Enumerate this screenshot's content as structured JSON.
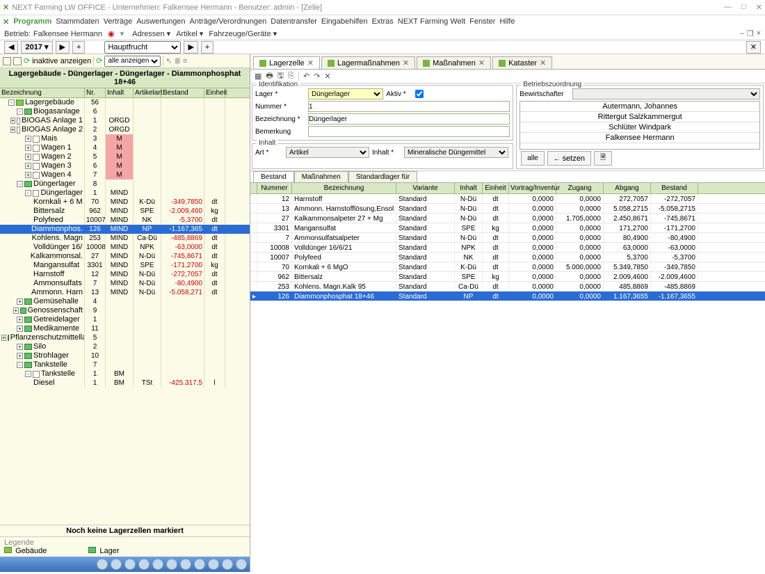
{
  "window": {
    "title": "NEXT Farming LW OFFICE - Unternehmen: Falkensee Hermann - Benutzer: admin - [Zelle]"
  },
  "menu": [
    "Programm",
    "Stammdaten",
    "Verträge",
    "Auswertungen",
    "Anträge/Verordnungen",
    "Datentransfer",
    "Eingabehilfen",
    "Extras",
    "NEXT Farming Welt",
    "Fenster",
    "Hilfe"
  ],
  "toolbar1": {
    "betrieb_label": "Betrieb:",
    "betrieb": "Falkensee Hermann",
    "items": [
      "Adressen",
      "Artikel",
      "Fahrzeuge/Geräte"
    ]
  },
  "yearbar": {
    "year": "2017 ▾",
    "crop": "Hauptfrucht"
  },
  "left": {
    "filter1": "inaktive anzeigen",
    "filter2": "alle anzeigen",
    "breadcrumb": "Lagergebäude - Düngerlager - Düngerlager - Diammonphosphat 18+46",
    "cols": [
      "Bezeichnung",
      "Nr.",
      "Inhalt",
      "Artikelart",
      "Bestand",
      "Einheit"
    ],
    "rows": [
      {
        "d": 0,
        "e": "-",
        "i": "bld",
        "bez": "Lagergebäude",
        "nr": "56"
      },
      {
        "d": 1,
        "e": "-",
        "i": "lag",
        "bez": "Biogasanlage",
        "nr": "6"
      },
      {
        "d": 2,
        "e": "+",
        "i": "chk",
        "bez": "BIOGAS Anlage 1",
        "nr": "1",
        "inh": "ORGD"
      },
      {
        "d": 2,
        "e": "+",
        "i": "chk",
        "bez": "BIOGAS Anlage 2",
        "nr": "2",
        "inh": "ORGD"
      },
      {
        "d": 2,
        "e": "+",
        "i": "chk",
        "bez": "Mais",
        "nr": "3",
        "inh": "M",
        "pink": true
      },
      {
        "d": 2,
        "e": "+",
        "i": "chk",
        "bez": "Wagen 1",
        "nr": "4",
        "inh": "M",
        "pink": true
      },
      {
        "d": 2,
        "e": "+",
        "i": "chk",
        "bez": "Wagen 2",
        "nr": "5",
        "inh": "M",
        "pink": true
      },
      {
        "d": 2,
        "e": "+",
        "i": "chk",
        "bez": "Wagen 3",
        "nr": "6",
        "inh": "M",
        "pink": true
      },
      {
        "d": 2,
        "e": "+",
        "i": "chk",
        "bez": "Wagen 4",
        "nr": "7",
        "inh": "M",
        "pink": true
      },
      {
        "d": 1,
        "e": "-",
        "i": "lag",
        "bez": "Düngerlager",
        "nr": "8"
      },
      {
        "d": 2,
        "e": "-",
        "i": "chk",
        "bez": "Düngerlager",
        "nr": "1",
        "inh": "MIND"
      },
      {
        "d": 3,
        "bez": "Kornkali + 6 M",
        "nr": "70",
        "inh": "MIND",
        "art": "K-Dü",
        "bes": "-349,7850",
        "ein": "dt",
        "neg": true
      },
      {
        "d": 3,
        "bez": "Bittersalz",
        "nr": "962",
        "inh": "MIND",
        "art": "SPE",
        "bes": "-2.009,460",
        "ein": "kg",
        "neg": true
      },
      {
        "d": 3,
        "bez": "Polyfeed",
        "nr": "10007",
        "inh": "MIND",
        "art": "NK",
        "bes": "-5,3700",
        "ein": "dt",
        "neg": true
      },
      {
        "d": 3,
        "bez": "Diammonphos.",
        "nr": "126",
        "inh": "MIND",
        "art": "NP",
        "bes": "-1.167,365",
        "ein": "dt",
        "neg": true,
        "sel": true
      },
      {
        "d": 3,
        "bez": "Kohlens. Magn",
        "nr": "253",
        "inh": "MIND",
        "art": "Ca-Dü",
        "bes": "-485,8869",
        "ein": "dt",
        "neg": true
      },
      {
        "d": 3,
        "bez": "Volldünger 16/",
        "nr": "10008",
        "inh": "MIND",
        "art": "NPK",
        "bes": "-63,0000",
        "ein": "dt",
        "neg": true
      },
      {
        "d": 3,
        "bez": "Kalkammonsal.",
        "nr": "27",
        "inh": "MIND",
        "art": "N-Dü",
        "bes": "-745,8671",
        "ein": "dt",
        "neg": true
      },
      {
        "d": 3,
        "bez": "Mangansulfat",
        "nr": "3301",
        "inh": "MIND",
        "art": "SPE",
        "bes": "-171,2700",
        "ein": "kg",
        "neg": true
      },
      {
        "d": 3,
        "bez": "Harnstoff",
        "nr": "12",
        "inh": "MIND",
        "art": "N-Dü",
        "bes": "-272,7057",
        "ein": "dt",
        "neg": true
      },
      {
        "d": 3,
        "bez": "Ammonsulfats",
        "nr": "7",
        "inh": "MIND",
        "art": "N-Dü",
        "bes": "-80,4900",
        "ein": "dt",
        "neg": true
      },
      {
        "d": 3,
        "bez": "Ammonn. Harn",
        "nr": "13",
        "inh": "MIND",
        "art": "N-Dü",
        "bes": "-5.058,271",
        "ein": "dt",
        "neg": true
      },
      {
        "d": 1,
        "e": "+",
        "i": "lag",
        "bez": "Gemüsehalle",
        "nr": "4"
      },
      {
        "d": 1,
        "e": "+",
        "i": "lag",
        "bez": "Genossenschaft",
        "nr": "9"
      },
      {
        "d": 1,
        "e": "+",
        "i": "lag",
        "bez": "Getreidelager",
        "nr": "1"
      },
      {
        "d": 1,
        "e": "+",
        "i": "lag",
        "bez": "Medikamente",
        "nr": "11"
      },
      {
        "d": 1,
        "e": "+",
        "i": "lag",
        "bez": "Pflanzenschutzmittella",
        "nr": "5"
      },
      {
        "d": 1,
        "e": "+",
        "i": "lag",
        "bez": "Silo",
        "nr": "2"
      },
      {
        "d": 1,
        "e": "+",
        "i": "lag",
        "bez": "Strohlager",
        "nr": "10"
      },
      {
        "d": 1,
        "e": "-",
        "i": "lag",
        "bez": "Tankstelle",
        "nr": "7"
      },
      {
        "d": 2,
        "e": "-",
        "i": "chk",
        "bez": "Tankstelle",
        "nr": "1",
        "inh": "BM"
      },
      {
        "d": 3,
        "bez": "Diesel",
        "nr": "1",
        "inh": "BM",
        "art": "TSt",
        "bes": "-425.317,5",
        "ein": "l",
        "neg": true
      }
    ],
    "status": "Noch keine Lagerzellen markiert",
    "legend_title": "Legende",
    "legend1": "Gebäude",
    "legend2": "Lager"
  },
  "right": {
    "tabs": [
      {
        "label": "Lagerzelle",
        "active": true
      },
      {
        "label": "Lagermaßnahmen"
      },
      {
        "label": "Maßnahmen"
      },
      {
        "label": "Kataster"
      }
    ],
    "ident": {
      "title": "Identifikation",
      "lager_label": "Lager",
      "lager": "Düngerlager",
      "aktiv_label": "Aktiv",
      "aktiv": true,
      "nummer_label": "Nummer",
      "nummer": "1",
      "bez_label": "Bezeichnung",
      "bez": "Düngerlager",
      "bem_label": "Bemerkung",
      "bem": ""
    },
    "bz": {
      "title": "Betriebszuordnung",
      "bew_label": "Bewirtschafter",
      "items": [
        "Autermann, Johannes",
        "Rittergut Salzkammergut",
        "Schlüter Windpark",
        "Falkensee Hermann"
      ],
      "btn_alle": "alle",
      "btn_setzen": "setzen"
    },
    "inhalt": {
      "title": "Inhalt",
      "art_label": "Art",
      "art": "Artikel",
      "inh_label": "Inhalt",
      "inh": "Mineralische Düngemittel"
    },
    "lowtabs": [
      "Bestand",
      "Maßnahmen",
      "Standardlager für"
    ],
    "gcols": [
      "",
      "Nummer",
      "Bezeichnung",
      "Variante",
      "Inhalt",
      "Einheit",
      "Vortrag/Inventur",
      "Zugang",
      "Abgang",
      "Bestand"
    ],
    "grows": [
      {
        "nr": "12",
        "bez": "Harnstoff",
        "var": "Standard",
        "inh": "N-Dü",
        "ein": "dt",
        "v": "0,0000",
        "z": "0,0000",
        "a": "272,7057",
        "b": "-272,7057"
      },
      {
        "nr": "13",
        "bez": "Ammonn. Harnstofflösung,Ensol",
        "var": "Standard",
        "inh": "N-Dü",
        "ein": "dt",
        "v": "0,0000",
        "z": "0,0000",
        "a": "5.058,2715",
        "b": "-5.058,2715"
      },
      {
        "nr": "27",
        "bez": "Kalkammonsalpeter 27 + Mg",
        "var": "Standard",
        "inh": "N-Dü",
        "ein": "dt",
        "v": "0,0000",
        "z": "1.705,0000",
        "a": "2.450,8671",
        "b": "-745,8671"
      },
      {
        "nr": "3301",
        "bez": "Mangansulfat",
        "var": "Standard",
        "inh": "SPE",
        "ein": "kg",
        "v": "0,0000",
        "z": "0,0000",
        "a": "171,2700",
        "b": "-171,2700"
      },
      {
        "nr": "7",
        "bez": "Ammonsulfatsalpeter",
        "var": "Standard",
        "inh": "N-Dü",
        "ein": "dt",
        "v": "0,0000",
        "z": "0,0000",
        "a": "80,4900",
        "b": "-80,4900"
      },
      {
        "nr": "10008",
        "bez": "Volldünger 16/6/21",
        "var": "Standard",
        "inh": "NPK",
        "ein": "dt",
        "v": "0,0000",
        "z": "0,0000",
        "a": "63,0000",
        "b": "-63,0000"
      },
      {
        "nr": "10007",
        "bez": "Polyfeed",
        "var": "Standard",
        "inh": "NK",
        "ein": "dt",
        "v": "0,0000",
        "z": "0,0000",
        "a": "5,3700",
        "b": "-5,3700"
      },
      {
        "nr": "70",
        "bez": "Kornkali + 6 MgO",
        "var": "Standard",
        "inh": "K-Dü",
        "ein": "dt",
        "v": "0,0000",
        "z": "5.000,0000",
        "a": "5.349,7850",
        "b": "-349,7850"
      },
      {
        "nr": "962",
        "bez": "Bittersalz",
        "var": "Standard",
        "inh": "SPE",
        "ein": "kg",
        "v": "0,0000",
        "z": "0,0000",
        "a": "2.009,4600",
        "b": "-2.009,4600"
      },
      {
        "nr": "253",
        "bez": "Kohlens. Magn.Kalk 95",
        "var": "Standard",
        "inh": "Ca-Dü",
        "ein": "dt",
        "v": "0,0000",
        "z": "0,0000",
        "a": "485,8869",
        "b": "-485,8869"
      },
      {
        "nr": "126",
        "bez": "Diammonphosphat 18+46",
        "var": "Standard",
        "inh": "NP",
        "ein": "dt",
        "v": "0,0000",
        "z": "0,0000",
        "a": "1.167,3655",
        "b": "-1.167,3655",
        "sel": true
      }
    ]
  }
}
